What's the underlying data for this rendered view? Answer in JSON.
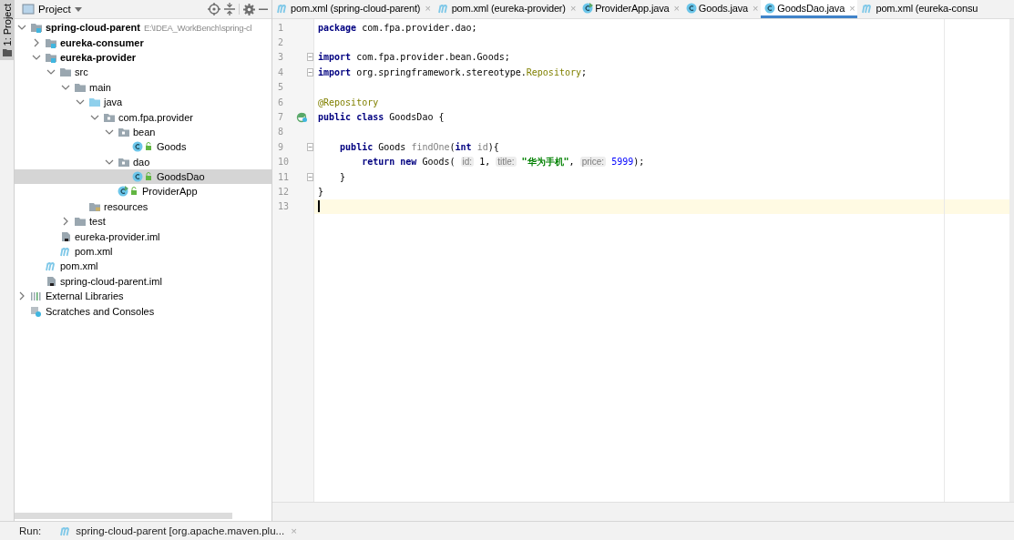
{
  "tool_stripe": {
    "label": "1: Project"
  },
  "project_panel": {
    "title": "Project",
    "tree": [
      {
        "kind": "module",
        "label": "spring-cloud-parent",
        "path": "E:\\IDEA_WorkBench\\spring-cl",
        "expanded": true,
        "selected": false,
        "children": [
          {
            "kind": "module",
            "label": "eureka-consumer",
            "expanded": false,
            "selected": false
          },
          {
            "kind": "module",
            "label": "eureka-provider",
            "expanded": true,
            "selected": false,
            "children": [
              {
                "kind": "folder",
                "label": "src",
                "expanded": true,
                "selected": false,
                "children": [
                  {
                    "kind": "folder",
                    "label": "main",
                    "expanded": true,
                    "selected": false,
                    "children": [
                      {
                        "kind": "source",
                        "label": "java",
                        "expanded": true,
                        "selected": false,
                        "children": [
                          {
                            "kind": "package",
                            "label": "com.fpa.provider",
                            "expanded": true,
                            "selected": false,
                            "children": [
                              {
                                "kind": "package",
                                "label": "bean",
                                "expanded": true,
                                "selected": false,
                                "children": [
                                  {
                                    "kind": "class",
                                    "label": "Goods",
                                    "selected": false
                                  }
                                ]
                              },
                              {
                                "kind": "package",
                                "label": "dao",
                                "expanded": true,
                                "selected": false,
                                "children": [
                                  {
                                    "kind": "class",
                                    "label": "GoodsDao",
                                    "selected": true
                                  }
                                ]
                              },
                              {
                                "kind": "spring",
                                "label": "ProviderApp",
                                "selected": false
                              }
                            ]
                          }
                        ]
                      },
                      {
                        "kind": "resources",
                        "label": "resources",
                        "selected": false
                      }
                    ]
                  },
                  {
                    "kind": "folder",
                    "label": "test",
                    "expanded": false,
                    "selected": false
                  }
                ]
              },
              {
                "kind": "iml",
                "label": "eureka-provider.iml",
                "selected": false
              },
              {
                "kind": "maven",
                "label": "pom.xml",
                "selected": false
              }
            ]
          },
          {
            "kind": "maven",
            "label": "pom.xml",
            "selected": false
          },
          {
            "kind": "iml",
            "label": "spring-cloud-parent.iml",
            "selected": false
          }
        ]
      },
      {
        "kind": "libraries",
        "label": "External Libraries",
        "expanded": false,
        "selected": false
      },
      {
        "kind": "scratches",
        "label": "Scratches and Consoles",
        "selected": false
      }
    ]
  },
  "editor": {
    "tabs": [
      {
        "kind": "maven",
        "label": "pom.xml (spring-cloud-parent)",
        "close": "×",
        "selected": false
      },
      {
        "kind": "maven",
        "label": "pom.xml (eureka-provider)",
        "close": "×",
        "selected": false
      },
      {
        "kind": "spring",
        "label": "ProviderApp.java",
        "close": "×",
        "selected": false
      },
      {
        "kind": "class",
        "label": "Goods.java",
        "close": "×",
        "selected": false
      },
      {
        "kind": "class",
        "label": "GoodsDao.java",
        "close": "×",
        "selected": true
      },
      {
        "kind": "maven",
        "label": "pom.xml (eureka-consu",
        "selected": false
      }
    ],
    "lines": [
      {
        "number": "1",
        "kind": "plain",
        "fold": false,
        "current": false,
        "tokens": [
          {
            "kind": "keyword",
            "text": "package"
          },
          {
            "kind": "plain",
            "text": " com.fpa.provider.dao;"
          }
        ]
      },
      {
        "number": "2",
        "kind": "plain",
        "fold": false,
        "current": false
      },
      {
        "number": "3",
        "kind": "plain",
        "fold": true,
        "current": false,
        "tokens": [
          {
            "kind": "keyword",
            "text": "import"
          },
          {
            "kind": "plain",
            "text": " com.fpa.provider.bean.Goods;"
          }
        ]
      },
      {
        "number": "4",
        "kind": "plain",
        "fold": true,
        "current": false,
        "tokens": [
          {
            "kind": "keyword",
            "text": "import"
          },
          {
            "kind": "plain",
            "text": " org.springframework.stereotype."
          },
          {
            "kind": "annotation",
            "text": "Repository"
          },
          {
            "kind": "plain",
            "text": ";"
          }
        ]
      },
      {
        "number": "5",
        "kind": "plain",
        "fold": false,
        "current": false
      },
      {
        "number": "6",
        "kind": "plain",
        "fold": false,
        "current": false,
        "tokens": [
          {
            "kind": "annotation",
            "text": "@Repository"
          }
        ]
      },
      {
        "number": "7",
        "kind": "bean",
        "fold": false,
        "current": false,
        "tokens": [
          {
            "kind": "keyword",
            "text": "public class"
          },
          {
            "kind": "plain",
            "text": " GoodsDao {"
          }
        ]
      },
      {
        "number": "8",
        "kind": "plain",
        "fold": false,
        "current": false
      },
      {
        "number": "9",
        "kind": "plain",
        "fold": true,
        "current": false,
        "tokens": [
          {
            "kind": "keyword",
            "text": "    public"
          },
          {
            "kind": "plain",
            "text": " Goods "
          },
          {
            "kind": "unused",
            "text": "findOne"
          },
          {
            "kind": "plain",
            "text": "("
          },
          {
            "kind": "keyword",
            "text": "int"
          },
          {
            "kind": "unused",
            "text": " id"
          },
          {
            "kind": "plain",
            "text": "){"
          }
        ]
      },
      {
        "number": "10",
        "kind": "plain",
        "fold": false,
        "current": false,
        "tokens": [
          {
            "kind": "keyword",
            "text": "        return new"
          },
          {
            "kind": "plain",
            "text": " Goods( "
          },
          {
            "kind": "hint",
            "text": "id:"
          },
          {
            "kind": "plain",
            "text": " 1, "
          },
          {
            "kind": "hint",
            "text": "title:"
          },
          {
            "kind": "string",
            "text": " \"华为手机\""
          },
          {
            "kind": "plain",
            "text": ", "
          },
          {
            "kind": "hint",
            "text": "price:"
          },
          {
            "kind": "number",
            "text": " 5999"
          },
          {
            "kind": "plain",
            "text": ");"
          }
        ]
      },
      {
        "number": "11",
        "kind": "plain",
        "fold": true,
        "current": false,
        "tokens": [
          {
            "kind": "plain",
            "text": "    }"
          }
        ]
      },
      {
        "number": "12",
        "kind": "plain",
        "fold": false,
        "current": false,
        "tokens": [
          {
            "kind": "plain",
            "text": "}"
          }
        ]
      },
      {
        "number": "13",
        "kind": "plain",
        "fold": false,
        "current": true
      }
    ]
  },
  "run_bar": {
    "label": "Run:",
    "tab": {
      "kind": "maven",
      "label": "spring-cloud-parent [org.apache.maven.plu...",
      "close": "×"
    }
  }
}
